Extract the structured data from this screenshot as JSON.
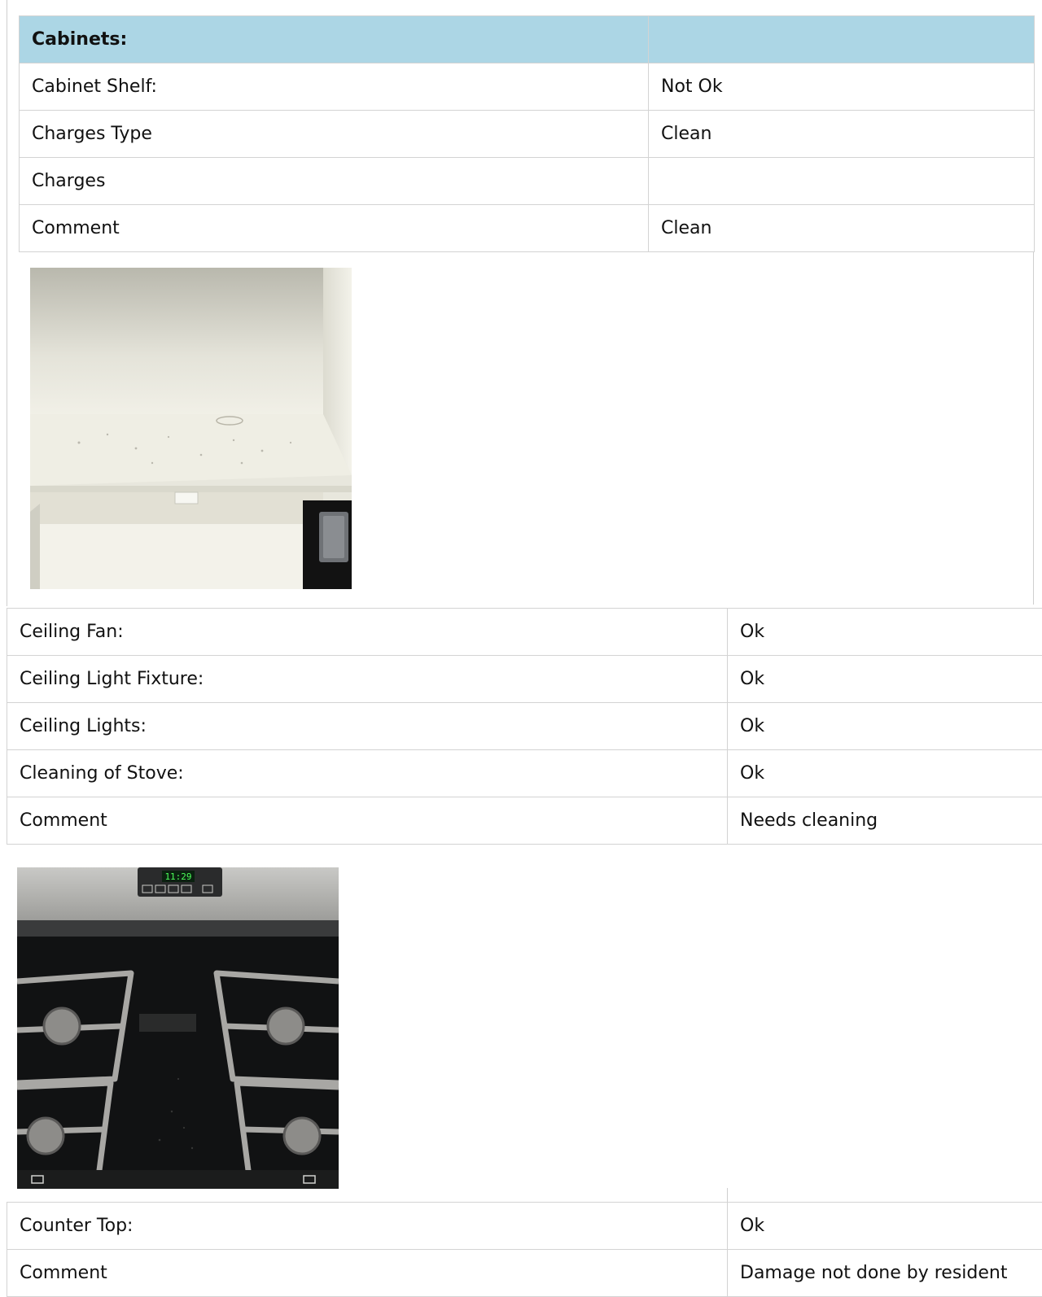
{
  "cabinets": {
    "title": "Cabinets:",
    "rows": [
      {
        "label": "Cabinet Shelf:",
        "value": "Not Ok"
      },
      {
        "label": "Charges Type",
        "value": "Clean"
      },
      {
        "label": "Charges",
        "value": ""
      },
      {
        "label": "Comment",
        "value": "Clean"
      }
    ]
  },
  "ceiling": {
    "rows": [
      {
        "label": "Ceiling Fan:",
        "value": "Ok"
      },
      {
        "label": "Ceiling Light Fixture:",
        "value": "Ok"
      },
      {
        "label": "Ceiling Lights:",
        "value": "Ok"
      },
      {
        "label": "Cleaning of Stove:",
        "value": "Ok"
      },
      {
        "label": "Comment",
        "value": "Needs cleaning"
      }
    ]
  },
  "stove_photo": {
    "timer": "11:29"
  },
  "counter": {
    "rows": [
      {
        "label": "Counter Top:",
        "value": "Ok"
      },
      {
        "label": "Comment",
        "value": "Damage not done by resident"
      }
    ]
  },
  "colors": {
    "header_bg": "#acd6e5",
    "border": "#d3d3d3"
  }
}
